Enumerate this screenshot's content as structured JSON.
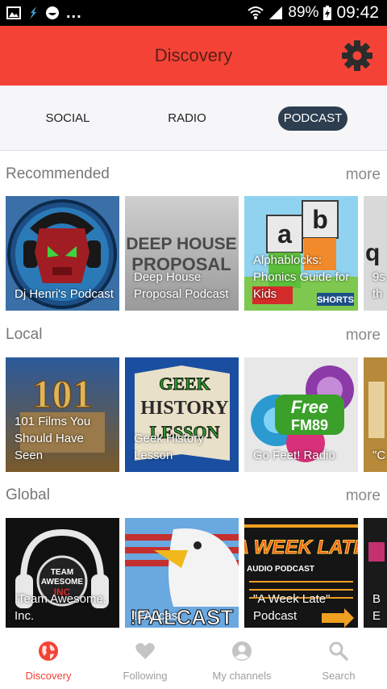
{
  "status_bar": {
    "notification_icons": [
      "image-icon",
      "flash-app-icon",
      "smiley-app-icon"
    ],
    "more_dots": "...",
    "wifi": "wifi-icon",
    "signal": "signal-icon",
    "battery": "89%",
    "time": "09:42"
  },
  "appbar": {
    "title": "Discovery",
    "settings_icon": "gear-icon",
    "color": "#f44336"
  },
  "tabs": [
    {
      "label": "SOCIAL",
      "selected": false
    },
    {
      "label": "RADIO",
      "selected": false
    },
    {
      "label": "PODCAST",
      "selected": true
    }
  ],
  "sections": [
    {
      "title": "Recommended",
      "more": "more",
      "cards": [
        {
          "label": "Dj Henri's Podcast"
        },
        {
          "label": "Deep House Proposal Podcast"
        },
        {
          "label": "Alphablocks: Phonics Guide for Kids"
        },
        {
          "label": "9s th"
        }
      ]
    },
    {
      "title": "Local",
      "more": "more",
      "cards": [
        {
          "label": "101 Films You Should Have Seen"
        },
        {
          "label": "Geek History Lesson"
        },
        {
          "label": "Go Feet! Radio"
        },
        {
          "label": "\"C"
        }
      ]
    },
    {
      "title": "Global",
      "more": "more",
      "cards": [
        {
          "label": "!Team Awesome, Inc."
        },
        {
          "label": "!FALcast"
        },
        {
          "label": "\"A Week Late\" Podcast"
        },
        {
          "label": "B E"
        }
      ]
    }
  ],
  "bottom_nav": [
    {
      "label": "Discovery",
      "icon": "globe-icon",
      "active": true
    },
    {
      "label": "Following",
      "icon": "heart-icon",
      "active": false
    },
    {
      "label": "My channels",
      "icon": "person-icon",
      "active": false
    },
    {
      "label": "Search",
      "icon": "search-icon",
      "active": false
    }
  ],
  "art_text": {
    "deep_house": "DEEP HOUSE PROPOSAL",
    "alpha_a": "a",
    "alpha_b": "b",
    "alpha_shorts": "SHORTS",
    "films_101": "101",
    "geek_history": "GEEK HISTORY LESSON",
    "free_fm": "Free FM89",
    "team_awesome": "TEAM AWESOME INC",
    "falcast": "!FALCAST",
    "week_late": "A WEEK LATE",
    "week_late_sub": "AUDIO PODCAST"
  }
}
